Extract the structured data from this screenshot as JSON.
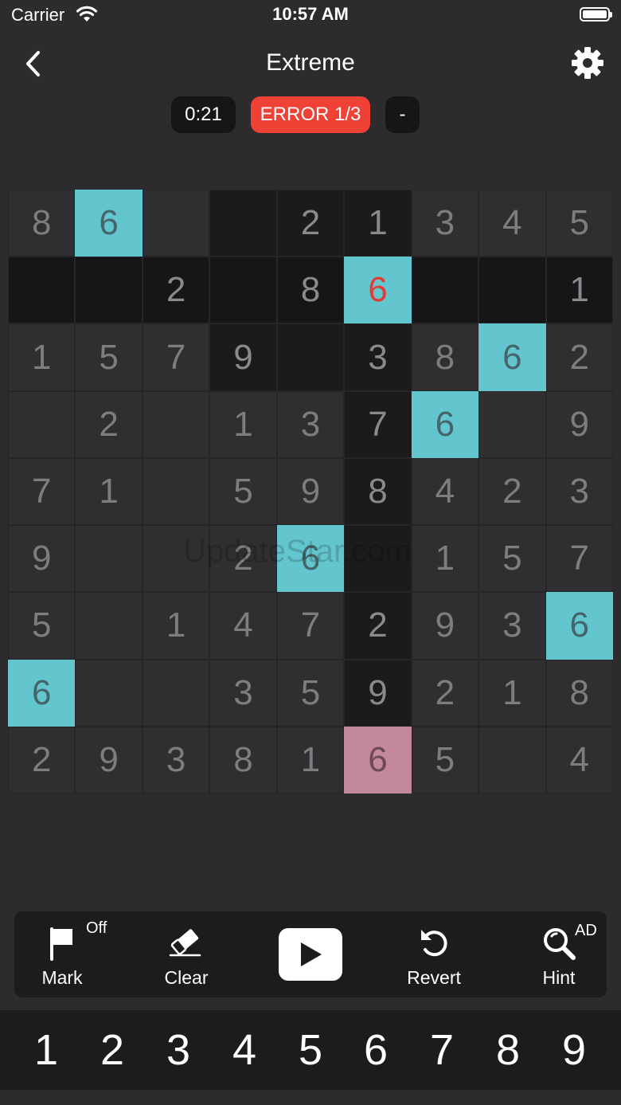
{
  "status_bar": {
    "carrier": "Carrier",
    "time": "10:57 AM"
  },
  "header": {
    "title": "Extreme",
    "back_icon": "chevron-left-icon",
    "settings_icon": "gear-icon"
  },
  "game_status": {
    "timer": "0:21",
    "error": "ERROR 1/3",
    "extra": "-"
  },
  "colors": {
    "highlight": "#63c6cf",
    "error_text": "#e43b35",
    "error_badge": "#ef4136",
    "selected_cell": "#c3889b"
  },
  "board": {
    "rows": [
      [
        "8",
        "6",
        "",
        "",
        "2",
        "1",
        "3",
        "4",
        "5"
      ],
      [
        "",
        "",
        "2",
        "",
        "8",
        "6",
        "",
        "",
        "1"
      ],
      [
        "1",
        "5",
        "7",
        "9",
        "",
        "3",
        "8",
        "6",
        "2"
      ],
      [
        "",
        "2",
        "",
        "1",
        "3",
        "7",
        "6",
        "",
        "9"
      ],
      [
        "7",
        "1",
        "",
        "5",
        "9",
        "8",
        "4",
        "2",
        "3"
      ],
      [
        "9",
        "",
        "",
        "2",
        "6",
        "",
        "1",
        "5",
        "7"
      ],
      [
        "5",
        "",
        "1",
        "4",
        "7",
        "2",
        "9",
        "3",
        "6"
      ],
      [
        "6",
        "",
        "",
        "3",
        "5",
        "9",
        "2",
        "1",
        "8"
      ],
      [
        "2",
        "9",
        "3",
        "8",
        "1",
        "6",
        "5",
        "",
        "4"
      ]
    ],
    "dark_cells": [
      "0-3",
      "0-4",
      "0-5",
      "1-0",
      "1-1",
      "1-2",
      "1-3",
      "1-4",
      "1-6",
      "1-7",
      "1-8",
      "2-3",
      "2-4",
      "2-5",
      "3-5",
      "4-5",
      "5-5",
      "6-5",
      "7-5"
    ],
    "highlighted_cells": [
      "0-1",
      "2-7",
      "3-6",
      "5-4",
      "6-8",
      "7-0"
    ],
    "error_cells": [
      "1-5"
    ],
    "selected_cells": [
      "8-5"
    ]
  },
  "watermark": "UpdateStar.com",
  "toolbar": {
    "mark": {
      "label": "Mark",
      "badge": "Off",
      "icon": "flag-icon"
    },
    "clear": {
      "label": "Clear",
      "icon": "eraser-icon"
    },
    "play": {
      "icon": "play-icon"
    },
    "revert": {
      "label": "Revert",
      "icon": "undo-icon"
    },
    "hint": {
      "label": "Hint",
      "badge": "AD",
      "icon": "magnifier-icon"
    }
  },
  "numpad": [
    "1",
    "2",
    "3",
    "4",
    "5",
    "6",
    "7",
    "8",
    "9"
  ]
}
